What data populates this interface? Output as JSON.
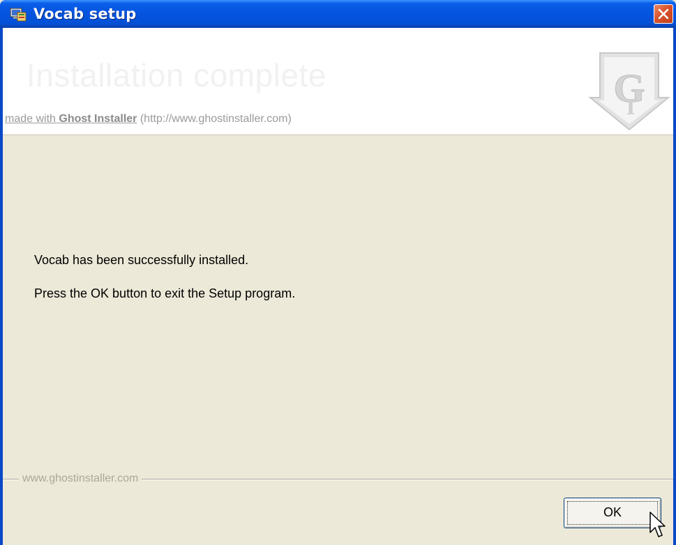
{
  "window": {
    "title": "Vocab setup",
    "close_icon": "close-icon"
  },
  "header": {
    "title": "Installation complete",
    "made_with_prefix": "made with ",
    "made_with_brand": "Ghost Installer",
    "url": " (http://www.ghostinstaller.com)",
    "logo_text": "GI"
  },
  "message": {
    "line1": "Vocab has been successfully installed.",
    "line2": "Press the OK button to exit the Setup program."
  },
  "footer": {
    "label": "www.ghostinstaller.com",
    "ok_label": "OK"
  },
  "colors": {
    "titlebar": "#0554e0",
    "client_bg": "#ece9d8",
    "close_red": "#d9532c"
  }
}
